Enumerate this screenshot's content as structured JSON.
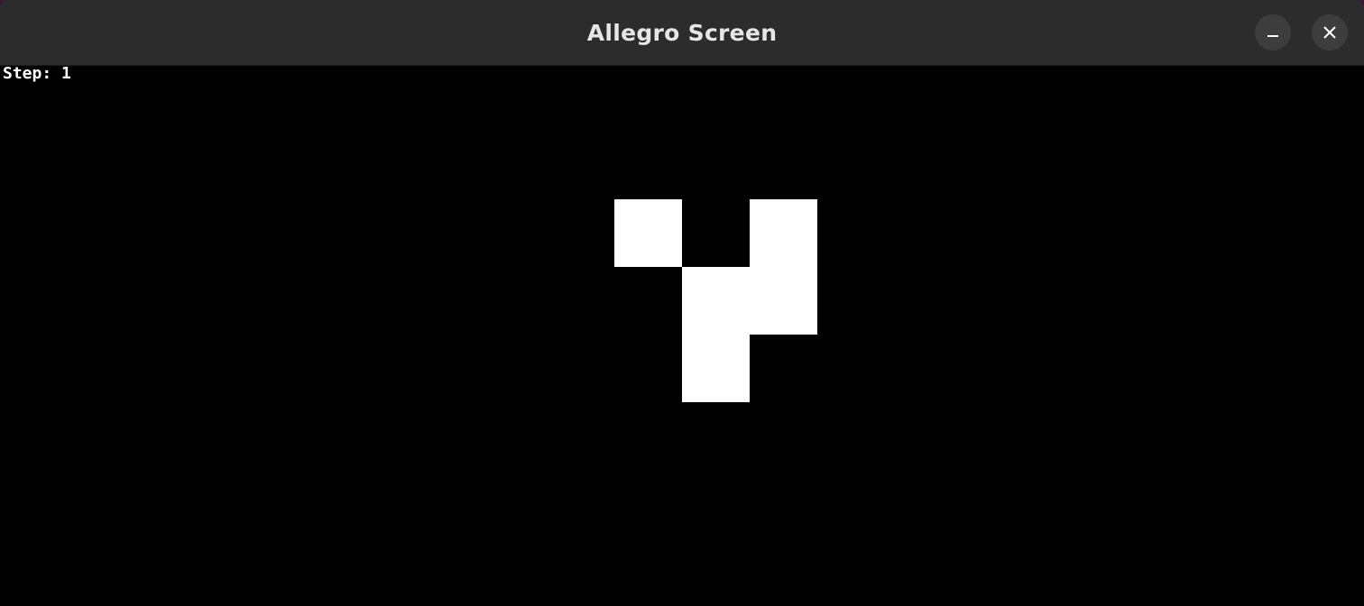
{
  "window": {
    "title": "Allegro Screen",
    "minimize_icon": "minimize-icon",
    "close_icon": "close-icon"
  },
  "hud": {
    "step_label": "Step:",
    "step_value": "1"
  },
  "board": {
    "cell_color": "#ffffff",
    "background_color": "#000000",
    "live_cells": [
      {
        "col": 0,
        "row": 0
      },
      {
        "col": 2,
        "row": 0
      },
      {
        "col": 1,
        "row": 1
      },
      {
        "col": 2,
        "row": 1
      },
      {
        "col": 1,
        "row": 2
      }
    ]
  }
}
